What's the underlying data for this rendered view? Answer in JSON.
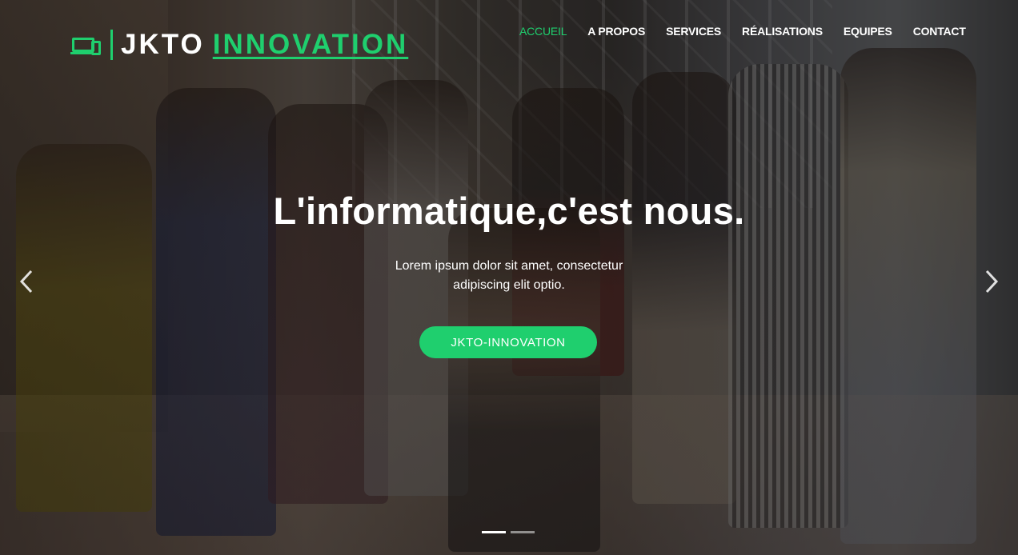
{
  "brand": {
    "name_part1": "JKTO",
    "name_part2": "INNOVATION",
    "accent_color": "#1fcf6e",
    "icon": "devices-icon"
  },
  "nav": {
    "items": [
      {
        "label": "ACCUEIL",
        "active": true
      },
      {
        "label": "A PROPOS",
        "active": false
      },
      {
        "label": "SERVICES",
        "active": false
      },
      {
        "label": "RÉALISATIONS",
        "active": false
      },
      {
        "label": "EQUIPES",
        "active": false
      },
      {
        "label": "CONTACT",
        "active": false
      }
    ]
  },
  "hero": {
    "title": "L'informatique,c'est nous.",
    "text_line1": "Lorem ipsum dolor sit amet, consectetur",
    "text_line2": "adipiscing elit optio.",
    "button_label": "JKTO-INNOVATION"
  },
  "carousel": {
    "prev_icon": "chevron-left-icon",
    "next_icon": "chevron-right-icon",
    "slide_count": 2,
    "active_slide": 1
  }
}
